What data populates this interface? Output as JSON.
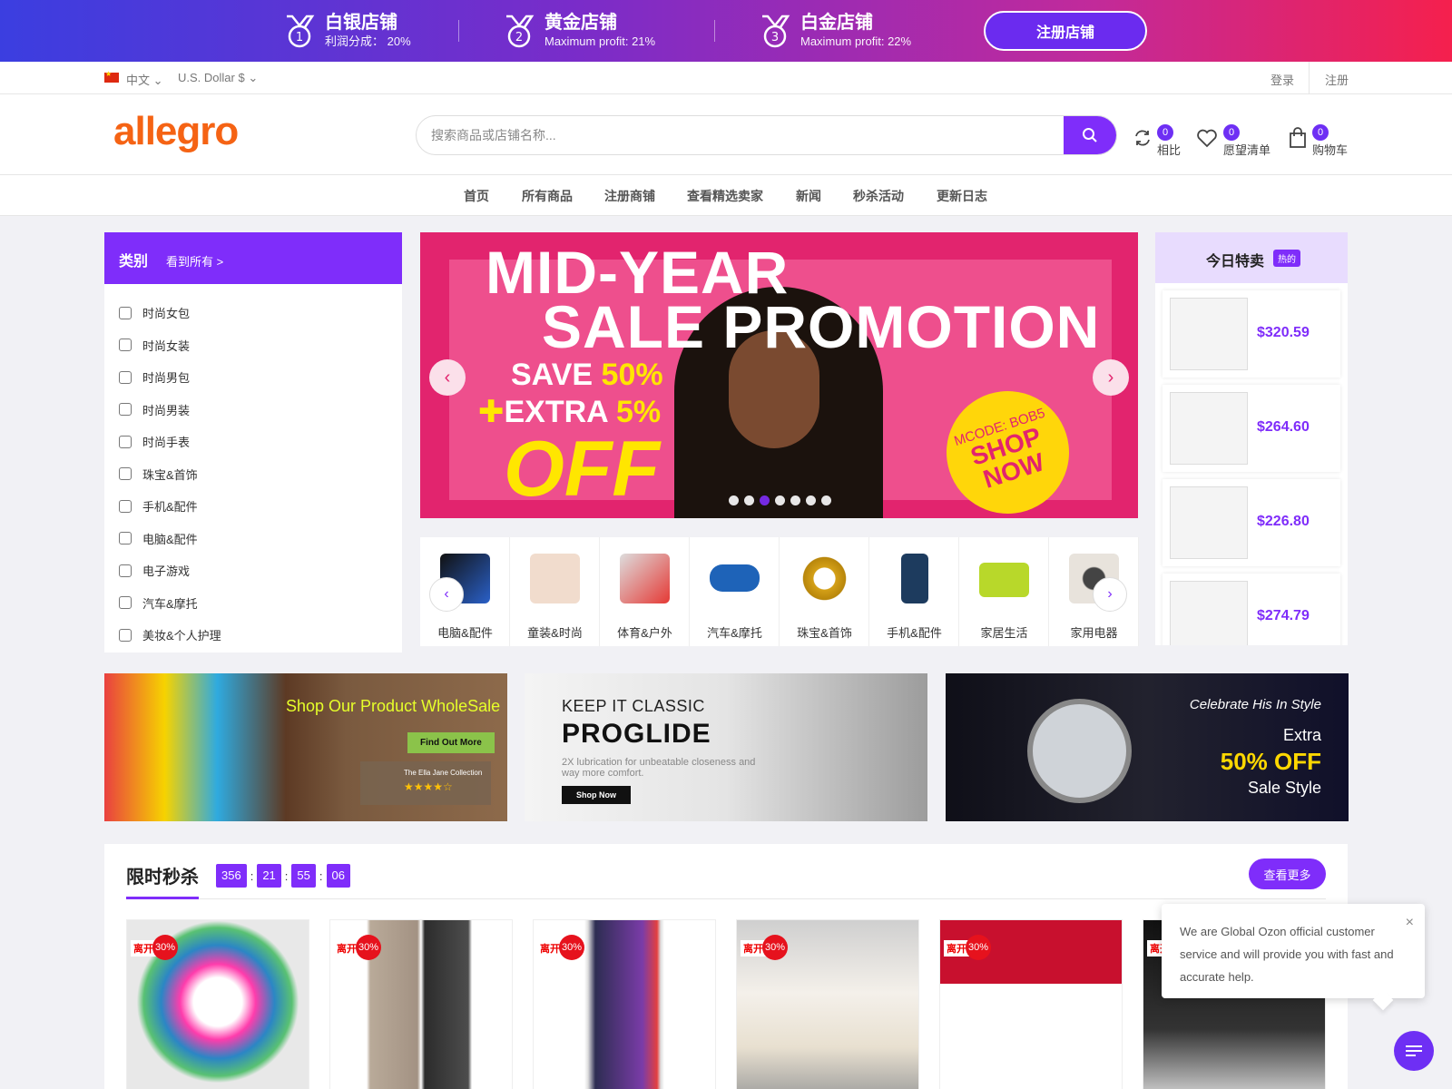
{
  "promo_bar": {
    "tiers": [
      {
        "name": "白银店铺",
        "sub": "利润分成： 20%"
      },
      {
        "name": "黄金店铺",
        "sub": "Maximum profit: 21%"
      },
      {
        "name": "白金店铺",
        "sub": "Maximum profit: 22%"
      }
    ],
    "cta": "注册店铺"
  },
  "util_bar": {
    "language": "中文",
    "currency": "U.S. Dollar $",
    "login": "登录",
    "register": "注册"
  },
  "header": {
    "logo": "allegro",
    "search_placeholder": "搜索商品或店铺名称...",
    "compare": {
      "label": "相比",
      "count": "0"
    },
    "wishlist": {
      "label": "愿望清单",
      "count": "0"
    },
    "cart": {
      "label": "购物车",
      "count": "0"
    }
  },
  "nav": [
    "首页",
    "所有商品",
    "注册商铺",
    "查看精选卖家",
    "新闻",
    "秒杀活动",
    "更新日志"
  ],
  "categories": {
    "title": "类别",
    "see_all": "看到所有 >",
    "items": [
      "时尚女包",
      "时尚女装",
      "时尚男包",
      "时尚男装",
      "时尚手表",
      "珠宝&首饰",
      "手机&配件",
      "电脑&配件",
      "电子游戏",
      "汽车&摩托",
      "美妆&个人护理"
    ]
  },
  "hero": {
    "line1": "MID-YEAR",
    "line2": "SALE PROMOTION",
    "save": "SAVE",
    "save_pct": "50%",
    "extra": "EXTRA",
    "extra_pct": "5%",
    "off": "OFF",
    "code": "MCODE: BOB5",
    "shop1": "SHOP",
    "shop2": "NOW",
    "slides": 7,
    "active_slide": 3
  },
  "category_strip": [
    "电脑&配件",
    "童装&时尚",
    "体育&户外",
    "汽车&摩托",
    "珠宝&首饰",
    "手机&配件",
    "家居生活",
    "家用电器"
  ],
  "deals": {
    "title": "今日特卖",
    "hot": "热的",
    "items": [
      {
        "price": "$320.59"
      },
      {
        "price": "$264.60"
      },
      {
        "price": "$226.80"
      },
      {
        "price": "$274.79"
      }
    ]
  },
  "promos": {
    "p1": {
      "title": "Shop Our Product WholeSale",
      "button": "Find Out More",
      "collection": "The Ella Jane Collection"
    },
    "p2": {
      "line1": "KEEP IT CLASSIC",
      "line2": "PROGLIDE",
      "line3": "2X lubrication for unbeatable closeness and way more comfort.",
      "button": "Shop Now"
    },
    "p3": {
      "line1": "Celebrate His In Style",
      "line2": "Extra",
      "line3": "50% OFF",
      "line4": "Sale Style"
    }
  },
  "flash": {
    "title": "限时秒杀",
    "timer": [
      "356",
      "21",
      "55",
      "06"
    ],
    "more": "查看更多",
    "tag": "离开",
    "pct": "30%"
  },
  "chat": {
    "message": "We are Global Ozon official customer service and will provide you with fast and accurate help."
  }
}
